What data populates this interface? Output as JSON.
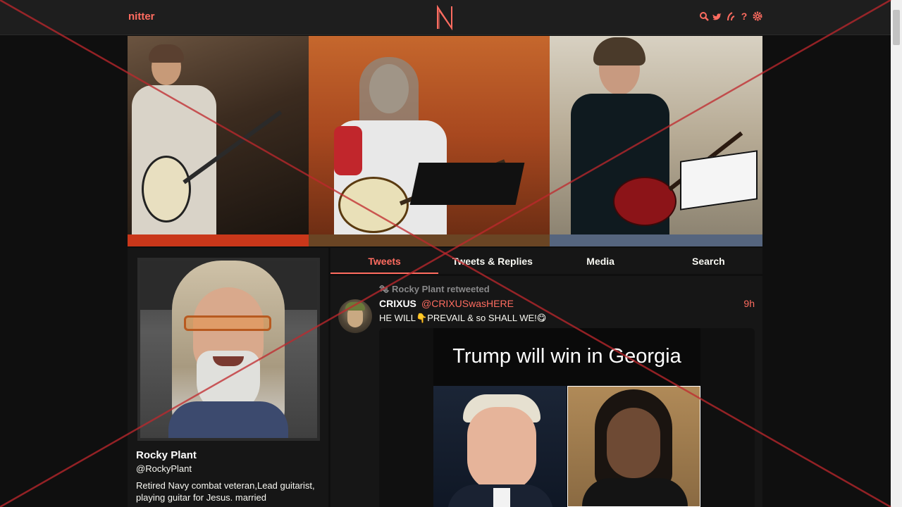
{
  "nav": {
    "brand": "nitter",
    "logo_letter": "N",
    "icons": [
      "search-icon",
      "bird-icon",
      "rss-icon",
      "help-icon",
      "gear-icon"
    ],
    "help_glyph": "?"
  },
  "colors": {
    "accent": "#ff6c60",
    "background": "#0f0f0f",
    "panel": "#161616",
    "navbar": "#1e1e1e",
    "overlay_x": "#c0282d"
  },
  "profile": {
    "fullname": "Rocky Plant",
    "username": "@RockyPlant",
    "bio": "Retired Navy combat veteran,Lead guitarist, playing guitar for Jesus. married"
  },
  "tabs": [
    {
      "label": "Tweets",
      "active": true
    },
    {
      "label": "Tweets & Replies",
      "active": false
    },
    {
      "label": "Media",
      "active": false
    },
    {
      "label": "Search",
      "active": false
    }
  ],
  "tweet": {
    "retweet_header": "Rocky Plant retweeted",
    "fullname": "CRIXUS",
    "username": "@CRIXUSwasHERE",
    "date": "9h",
    "content": "HE WILL👇PREVAIL & so SHALL WE!😋",
    "media_caption": "Trump will win in Georgia"
  }
}
